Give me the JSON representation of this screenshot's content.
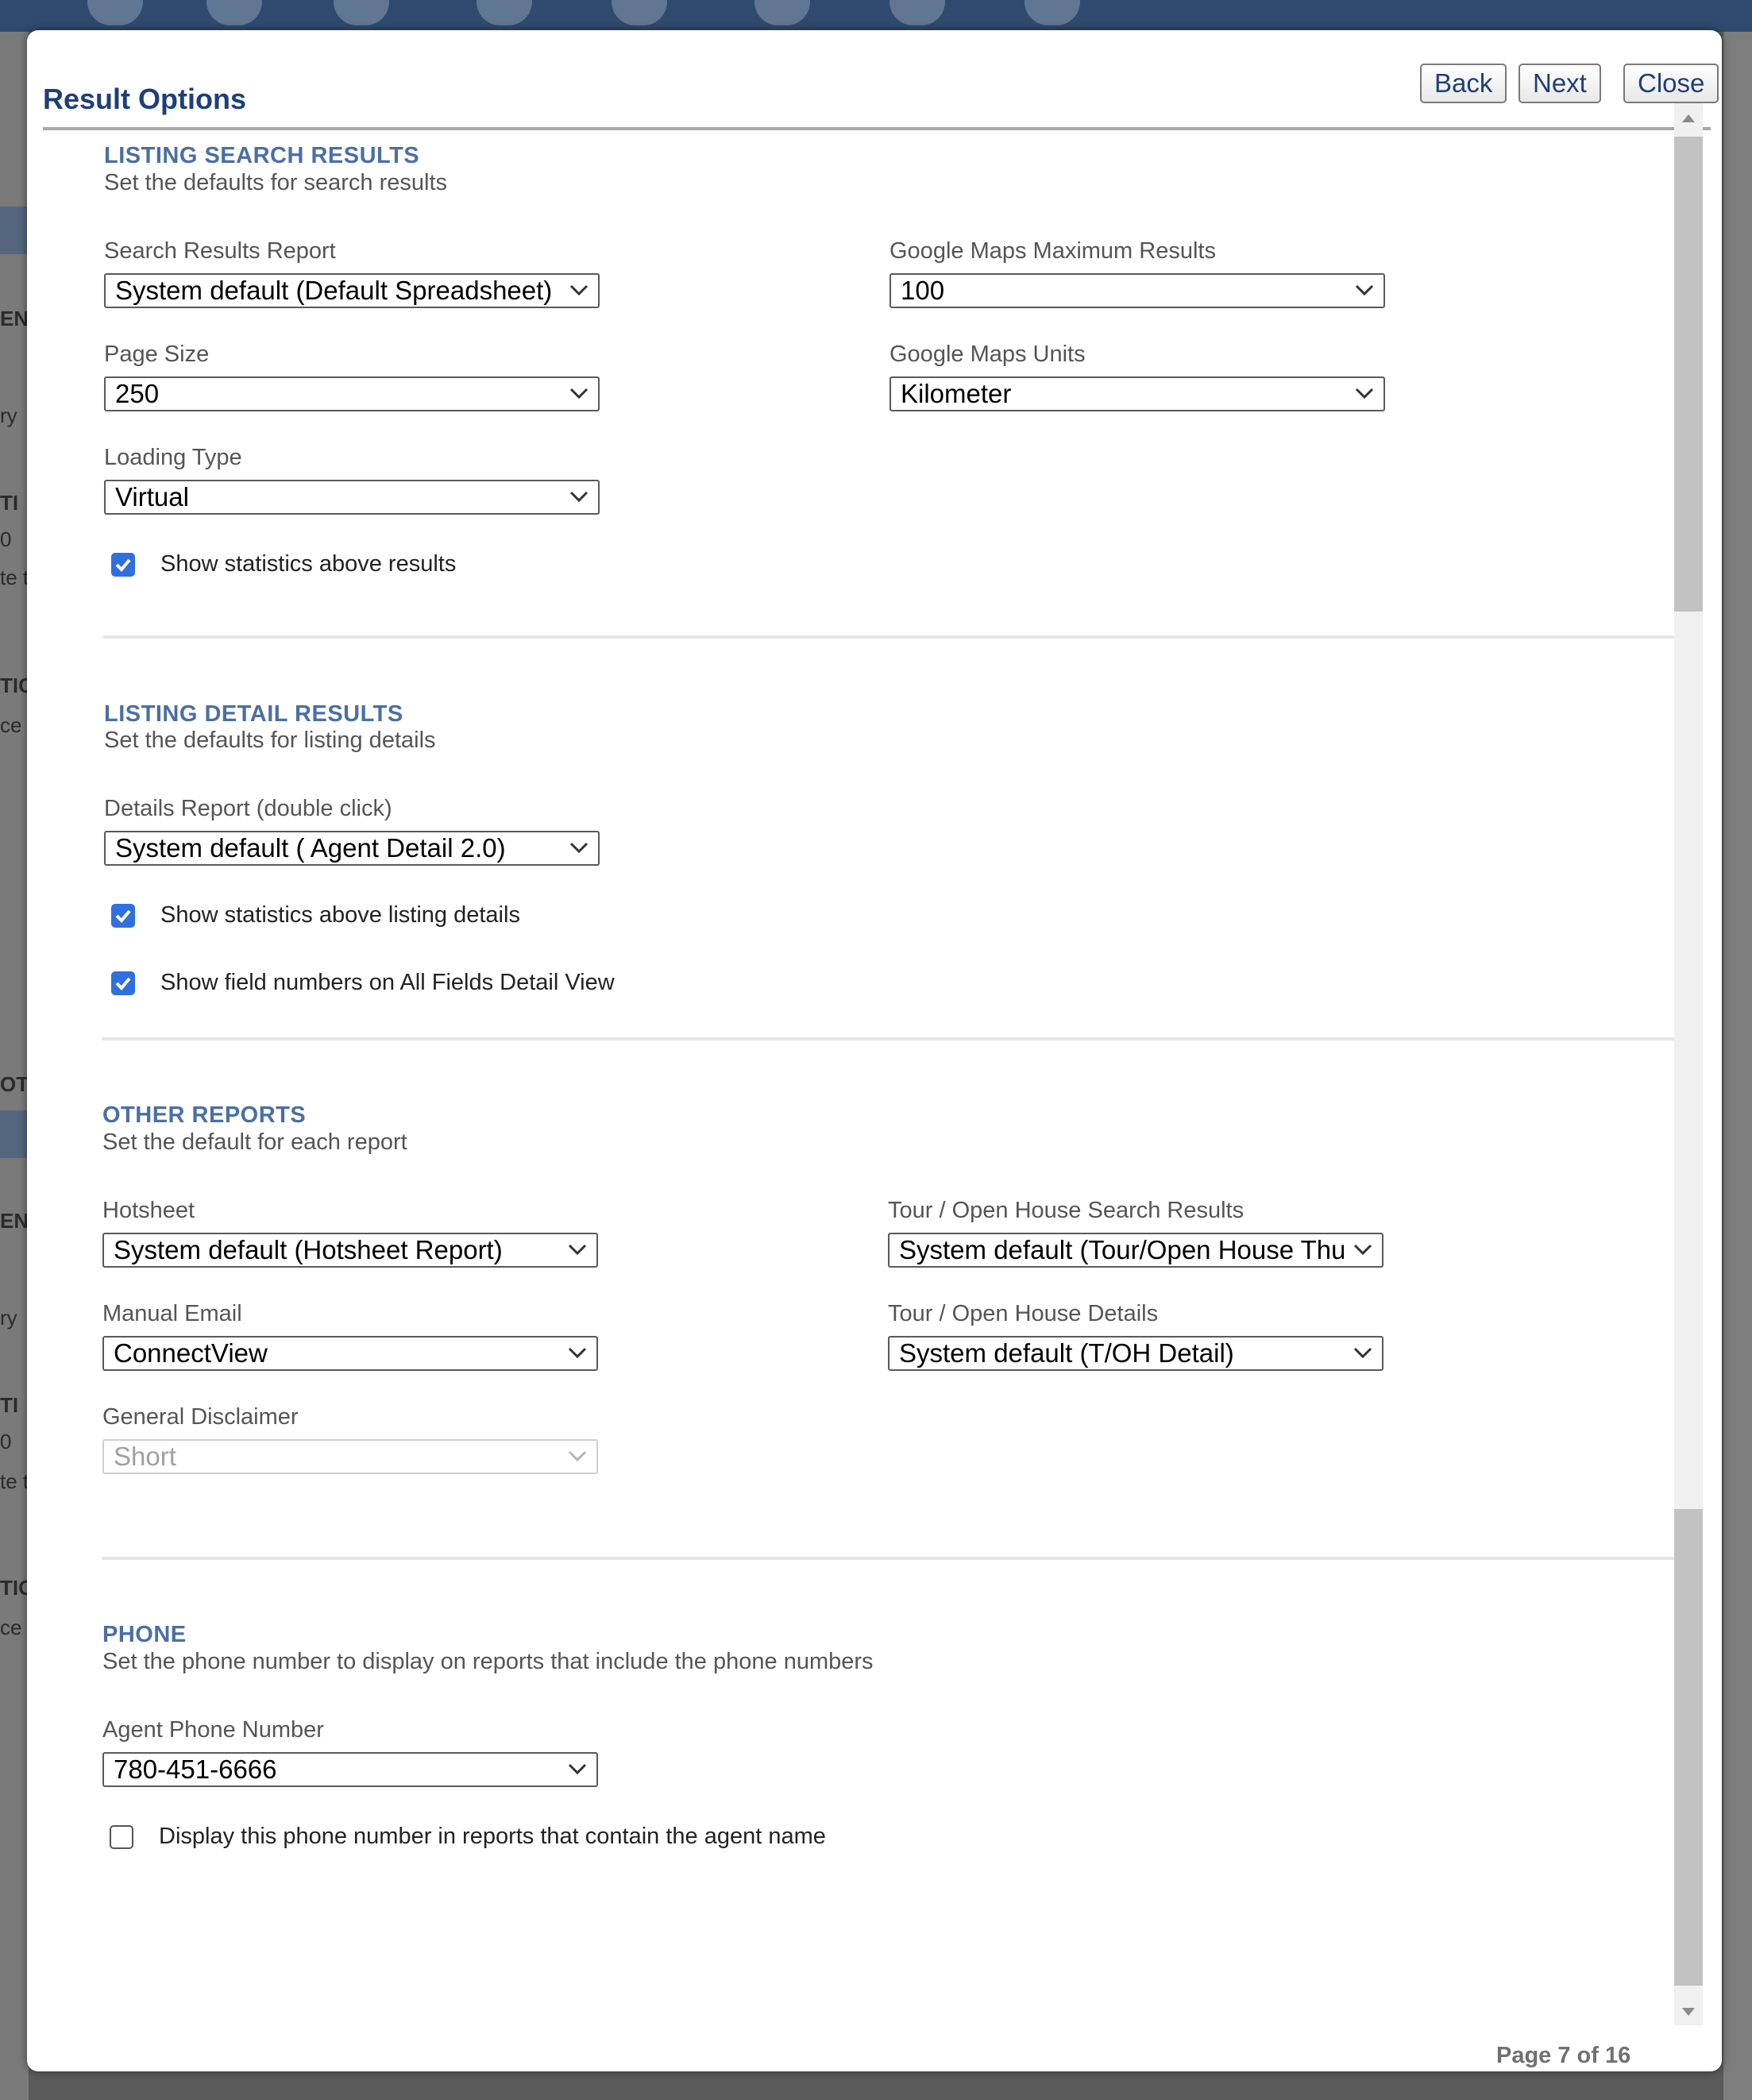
{
  "modal": {
    "title": "Result Options",
    "buttons": {
      "back": "Back",
      "next": "Next",
      "close": "Close"
    },
    "page_indicator": "Page 7 of 16"
  },
  "listing_search": {
    "title": "LISTING SEARCH RESULTS",
    "subtitle": "Set the defaults for search results",
    "search_results_report": {
      "label": "Search Results Report",
      "value": "System default (Default Spreadsheet)"
    },
    "page_size": {
      "label": "Page Size",
      "value": "250"
    },
    "loading_type": {
      "label": "Loading Type",
      "value": "Virtual"
    },
    "google_max": {
      "label": "Google Maps Maximum Results",
      "value": "100"
    },
    "google_units": {
      "label": "Google Maps Units",
      "value": "Kilometer"
    },
    "show_stats": {
      "label": "Show statistics above results",
      "checked": true
    }
  },
  "listing_detail": {
    "title": "LISTING DETAIL RESULTS",
    "subtitle": "Set the defaults for listing details",
    "details_report": {
      "label": "Details Report (double click)",
      "value": "System default ( Agent Detail 2.0)"
    },
    "show_stats": {
      "label": "Show statistics above listing details",
      "checked": true
    },
    "show_field_numbers": {
      "label": "Show field numbers on All Fields Detail View",
      "checked": true
    }
  },
  "other_reports": {
    "title": "OTHER REPORTS",
    "subtitle": "Set the default for each report",
    "hotsheet": {
      "label": "Hotsheet",
      "value": "System default (Hotsheet Report)"
    },
    "manual_email": {
      "label": "Manual Email",
      "value": "ConnectView"
    },
    "general_disclaimer": {
      "label": "General Disclaimer",
      "value": "Short",
      "disabled": true
    },
    "tour_search": {
      "label": "Tour / Open House Search Results",
      "value": "System default (Tour/Open House Thu"
    },
    "tour_details": {
      "label": "Tour / Open House Details",
      "value": "System default (T/OH Detail)"
    }
  },
  "phone": {
    "title": "PHONE",
    "subtitle": "Set the phone number to display on reports that include the phone numbers",
    "agent_phone": {
      "label": "Agent Phone Number",
      "value": "780-451-6666"
    },
    "display_in_reports": {
      "label": "Display this phone number in reports that contain the agent name",
      "checked": false
    }
  },
  "background_fragments": [
    "EN",
    "ry",
    "TI",
    "0",
    "te t",
    "TIO",
    "ce E",
    "OTI",
    "EN",
    "ry",
    "TI",
    "0",
    "te t",
    "TIO",
    "ce E"
  ],
  "colors": {
    "accent": "#1f3f7a",
    "section_title": "#4a6fa5",
    "checkbox": "#2f6fe0"
  }
}
